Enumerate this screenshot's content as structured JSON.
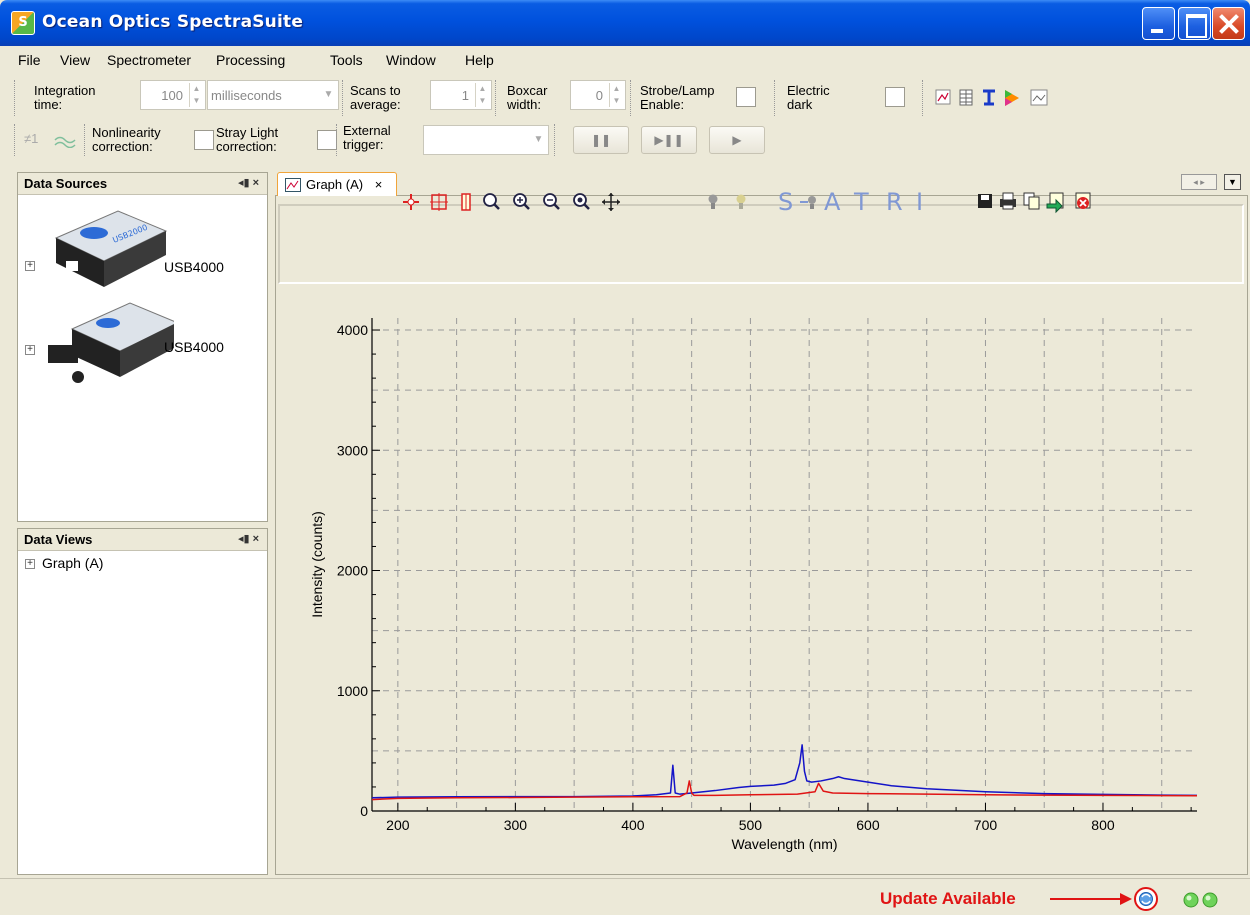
{
  "window": {
    "title": "Ocean Optics SpectraSuite",
    "icon_text": "S"
  },
  "menu": [
    "File",
    "View",
    "Spectrometer",
    "Processing",
    "Tools",
    "Window",
    "Help"
  ],
  "toolbar": {
    "integration_label": "Integration time:",
    "integration_value": "100",
    "integration_unit": "milliseconds",
    "scans_label": "Scans to average:",
    "scans_value": "1",
    "boxcar_label": "Boxcar width:",
    "boxcar_value": "0",
    "strobe_label": "Strobe/Lamp Enable:",
    "electric_dark_label": "Electric dark",
    "nonlinearity_prefix": "≠1",
    "nonlinearity_label": "Nonlinearity correction:",
    "stray_light_label": "Stray Light correction:",
    "external_trigger_label": "External trigger:",
    "pause_glyph": "❚❚",
    "step_glyph": "▶❚❚",
    "play_glyph": "▶"
  },
  "data_sources": {
    "title": "Data Sources",
    "ctrl": "◂▮ ×",
    "devices": [
      {
        "label": "USB4000",
        "badge": "USB2000"
      },
      {
        "label": "USB4000",
        "badge": ""
      }
    ]
  },
  "data_views": {
    "title": "Data Views",
    "ctrl": "◂▮ ×",
    "items": [
      {
        "label": "Graph (A)"
      }
    ]
  },
  "graph_tab": {
    "label": "Graph (A)",
    "close": "×"
  },
  "graph_tools": {
    "sairi_letters": [
      "S",
      "A",
      "T",
      "R",
      "I"
    ]
  },
  "status": {
    "update_text": "Update Available"
  },
  "colors": {
    "blue_series": "#1414c8",
    "red_series": "#e01414",
    "accent_update": "#e01414"
  },
  "chart_data": {
    "type": "line",
    "xlabel": "Wavelength (nm)",
    "ylabel": "Intensity (counts)",
    "xlim": [
      178,
      880
    ],
    "ylim": [
      0,
      4100
    ],
    "xticks": [
      200,
      300,
      400,
      500,
      600,
      700,
      800
    ],
    "yticks": [
      0,
      1000,
      2000,
      3000,
      4000
    ],
    "grid": true,
    "series": [
      {
        "color": "#1414c8",
        "x": [
          178,
          200,
          250,
          300,
          350,
          400,
          420,
          432,
          434,
          436,
          440,
          450,
          470,
          490,
          500,
          520,
          530,
          538,
          542,
          544,
          546,
          548,
          552,
          560,
          570,
          575,
          580,
          600,
          620,
          650,
          700,
          750,
          800,
          850,
          880
        ],
        "y": [
          110,
          115,
          118,
          120,
          120,
          125,
          135,
          150,
          380,
          150,
          140,
          150,
          170,
          195,
          205,
          215,
          230,
          260,
          400,
          550,
          330,
          250,
          240,
          250,
          270,
          285,
          270,
          240,
          210,
          185,
          160,
          145,
          138,
          132,
          130
        ]
      },
      {
        "color": "#e01414",
        "x": [
          178,
          200,
          250,
          300,
          350,
          400,
          440,
          446,
          448,
          450,
          452,
          470,
          500,
          540,
          555,
          558,
          562,
          570,
          600,
          650,
          700,
          750,
          800,
          850,
          880
        ],
        "y": [
          95,
          105,
          110,
          112,
          115,
          118,
          120,
          150,
          250,
          150,
          130,
          130,
          135,
          140,
          160,
          230,
          165,
          150,
          145,
          140,
          135,
          132,
          130,
          128,
          127
        ]
      }
    ]
  }
}
